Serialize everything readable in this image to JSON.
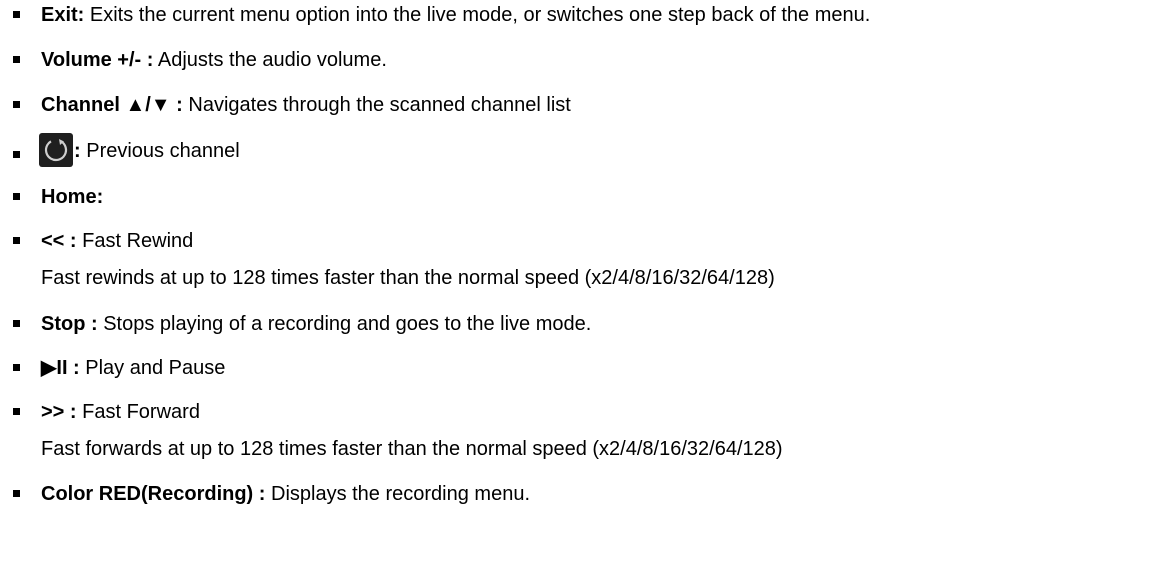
{
  "items": [
    {
      "term": "Exit:",
      "desc": " Exits the current menu option into the live mode, or switches one step back of the menu."
    },
    {
      "term": "Volume +/- :",
      "desc": " Adjusts the audio volume."
    },
    {
      "term": "Channel ▲/▼ :",
      "desc": " Navigates through the scanned channel list"
    },
    {
      "icon": "previous-channel-icon",
      "term": ":",
      "desc": " Previous channel"
    },
    {
      "term": "Home:",
      "desc": ""
    },
    {
      "term": "<< :",
      "desc": " Fast Rewind",
      "continuation": "Fast rewinds at up to 128 times faster than the normal speed (x2/4/8/16/32/64/128)"
    },
    {
      "term": "Stop :",
      "desc": " Stops playing of a recording and goes to the live mode."
    },
    {
      "term": "▶II :",
      "desc": " Play and Pause"
    },
    {
      "term": ">> :",
      "desc": " Fast Forward",
      "continuation": "Fast forwards at up to 128 times faster than the normal speed (x2/4/8/16/32/64/128)"
    },
    {
      "term": "Color RED(Recording) :",
      "desc": " Displays the recording menu."
    }
  ]
}
